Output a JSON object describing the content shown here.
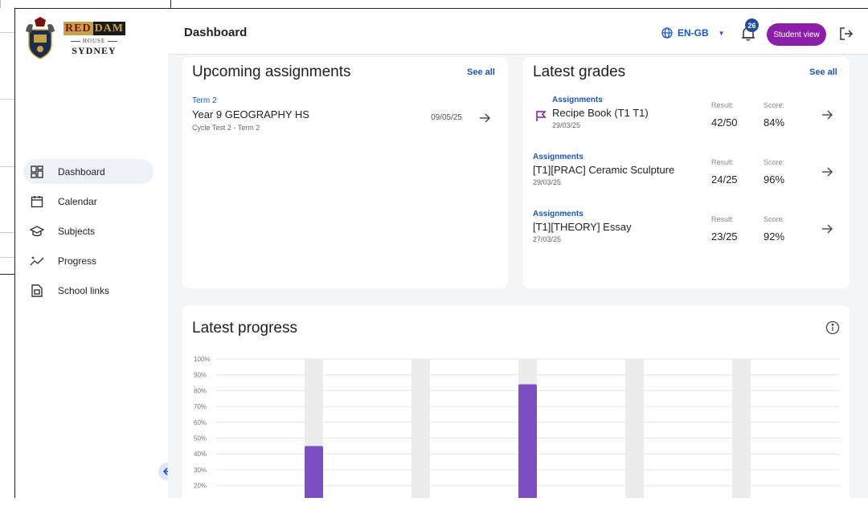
{
  "brand": {
    "name_part1": "RED",
    "name_part2": "DAM",
    "house": "HOUSE",
    "city": "SYDNEY"
  },
  "header": {
    "title": "Dashboard",
    "language": "EN-GB",
    "notification_count": "26",
    "student_view_label": "Student view"
  },
  "sidebar": {
    "items": [
      {
        "label": "Dashboard",
        "icon": "dashboard-icon",
        "active": true
      },
      {
        "label": "Calendar",
        "icon": "calendar-icon"
      },
      {
        "label": "Subjects",
        "icon": "subjects-icon"
      },
      {
        "label": "Progress",
        "icon": "progress-icon"
      },
      {
        "label": "School links",
        "icon": "school-links-icon"
      }
    ]
  },
  "assignments": {
    "title": "Upcoming assignments",
    "see_all": "See all",
    "items": [
      {
        "term": "Term 2",
        "name": "Year 9 GEOGRAPHY HS",
        "sub": "Cycle Test 2 - Term 2",
        "date": "09/05/25"
      }
    ]
  },
  "grades": {
    "title": "Latest grades",
    "see_all": "See all",
    "result_label": "Result:",
    "score_label": "Score:",
    "items": [
      {
        "category": "Assignments",
        "name": "Recipe Book (T1 T1)",
        "date": "29/03/25",
        "result": "42/50",
        "score": "84%",
        "flagged": true
      },
      {
        "category": "Assignments",
        "name": "[T1][PRAC] Ceramic Sculpture",
        "date": "29/03/25",
        "result": "24/25",
        "score": "96%"
      },
      {
        "category": "Assignments",
        "name": "[T1][THEORY] Essay",
        "date": "27/03/25",
        "result": "23/25",
        "score": "92%"
      }
    ]
  },
  "progress": {
    "title": "Latest progress"
  },
  "chart_data": {
    "type": "bar",
    "ylim": [
      0,
      100
    ],
    "y_ticks": [
      "100%",
      "90%",
      "80%",
      "70%",
      "60%",
      "50%",
      "40%",
      "30%",
      "20%"
    ],
    "values": [
      45,
      null,
      84,
      null,
      null
    ],
    "bar_color": "#7e4fc2",
    "track_color": "#ececec"
  },
  "colors": {
    "accent": "#1a56c4",
    "student_view": "#8c1fa8",
    "bar": "#7e4fc2",
    "badge": "#1f4ea0"
  }
}
